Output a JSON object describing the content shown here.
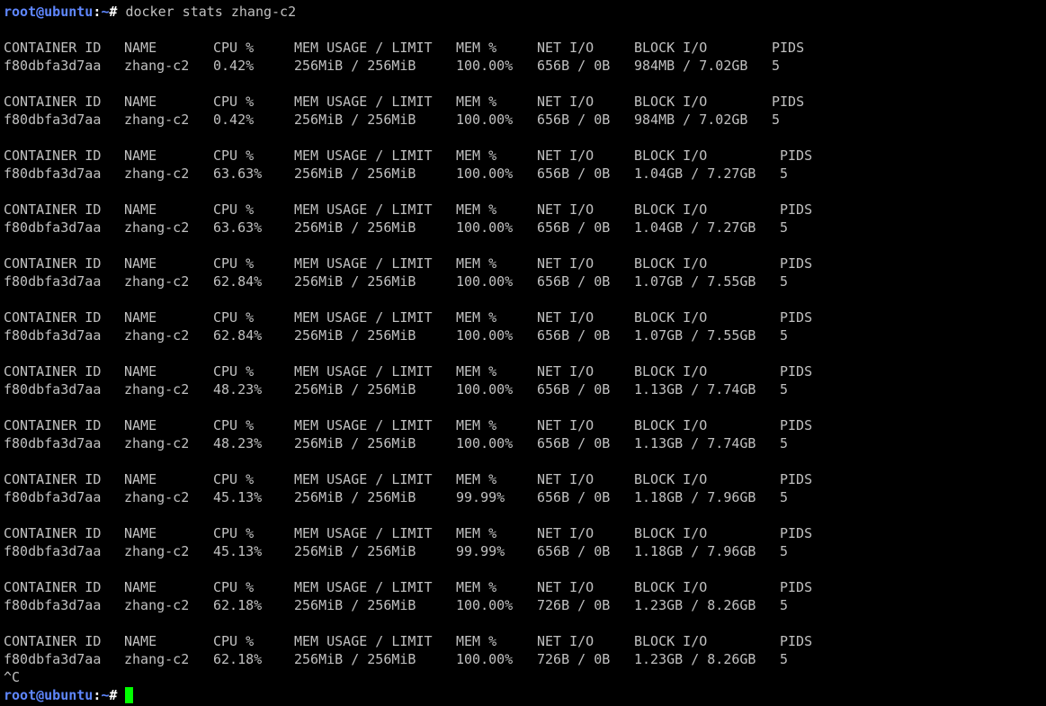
{
  "prompt": {
    "user_host": "root@ubuntu",
    "separator": ":",
    "path": "~",
    "symbol": "#"
  },
  "command": "docker stats zhang-c2",
  "headers": {
    "container_id": "CONTAINER ID",
    "name": "NAME",
    "cpu": "CPU %",
    "mem_usage": "MEM USAGE / LIMIT",
    "mem_pct": "MEM %",
    "net_io": "NET I/O",
    "block_io": "BLOCK I/O",
    "pids": "PIDS"
  },
  "snapshots": [
    {
      "id": "f80dbfa3d7aa",
      "name": "zhang-c2",
      "cpu": "0.42%",
      "mem": "256MiB / 256MiB",
      "mem_pct": "100.00%",
      "net": "656B / 0B",
      "block": "984MB / 7.02GB",
      "pids": "5"
    },
    {
      "id": "f80dbfa3d7aa",
      "name": "zhang-c2",
      "cpu": "0.42%",
      "mem": "256MiB / 256MiB",
      "mem_pct": "100.00%",
      "net": "656B / 0B",
      "block": "984MB / 7.02GB",
      "pids": "5"
    },
    {
      "id": "f80dbfa3d7aa",
      "name": "zhang-c2",
      "cpu": "63.63%",
      "mem": "256MiB / 256MiB",
      "mem_pct": "100.00%",
      "net": "656B / 0B",
      "block": "1.04GB / 7.27GB",
      "pids": "5"
    },
    {
      "id": "f80dbfa3d7aa",
      "name": "zhang-c2",
      "cpu": "63.63%",
      "mem": "256MiB / 256MiB",
      "mem_pct": "100.00%",
      "net": "656B / 0B",
      "block": "1.04GB / 7.27GB",
      "pids": "5"
    },
    {
      "id": "f80dbfa3d7aa",
      "name": "zhang-c2",
      "cpu": "62.84%",
      "mem": "256MiB / 256MiB",
      "mem_pct": "100.00%",
      "net": "656B / 0B",
      "block": "1.07GB / 7.55GB",
      "pids": "5"
    },
    {
      "id": "f80dbfa3d7aa",
      "name": "zhang-c2",
      "cpu": "62.84%",
      "mem": "256MiB / 256MiB",
      "mem_pct": "100.00%",
      "net": "656B / 0B",
      "block": "1.07GB / 7.55GB",
      "pids": "5"
    },
    {
      "id": "f80dbfa3d7aa",
      "name": "zhang-c2",
      "cpu": "48.23%",
      "mem": "256MiB / 256MiB",
      "mem_pct": "100.00%",
      "net": "656B / 0B",
      "block": "1.13GB / 7.74GB",
      "pids": "5"
    },
    {
      "id": "f80dbfa3d7aa",
      "name": "zhang-c2",
      "cpu": "48.23%",
      "mem": "256MiB / 256MiB",
      "mem_pct": "100.00%",
      "net": "656B / 0B",
      "block": "1.13GB / 7.74GB",
      "pids": "5"
    },
    {
      "id": "f80dbfa3d7aa",
      "name": "zhang-c2",
      "cpu": "45.13%",
      "mem": "256MiB / 256MiB",
      "mem_pct": "99.99%",
      "net": "656B / 0B",
      "block": "1.18GB / 7.96GB",
      "pids": "5"
    },
    {
      "id": "f80dbfa3d7aa",
      "name": "zhang-c2",
      "cpu": "45.13%",
      "mem": "256MiB / 256MiB",
      "mem_pct": "99.99%",
      "net": "656B / 0B",
      "block": "1.18GB / 7.96GB",
      "pids": "5"
    },
    {
      "id": "f80dbfa3d7aa",
      "name": "zhang-c2",
      "cpu": "62.18%",
      "mem": "256MiB / 256MiB",
      "mem_pct": "100.00%",
      "net": "726B / 0B",
      "block": "1.23GB / 8.26GB",
      "pids": "5"
    },
    {
      "id": "f80dbfa3d7aa",
      "name": "zhang-c2",
      "cpu": "62.18%",
      "mem": "256MiB / 256MiB",
      "mem_pct": "100.00%",
      "net": "726B / 0B",
      "block": "1.23GB / 8.26GB",
      "pids": "5"
    }
  ],
  "interrupt": "^C",
  "colors": {
    "background": "#000000",
    "text": "#c0c0c0",
    "prompt_user": "#5f87ff",
    "cursor": "#00ff00"
  }
}
